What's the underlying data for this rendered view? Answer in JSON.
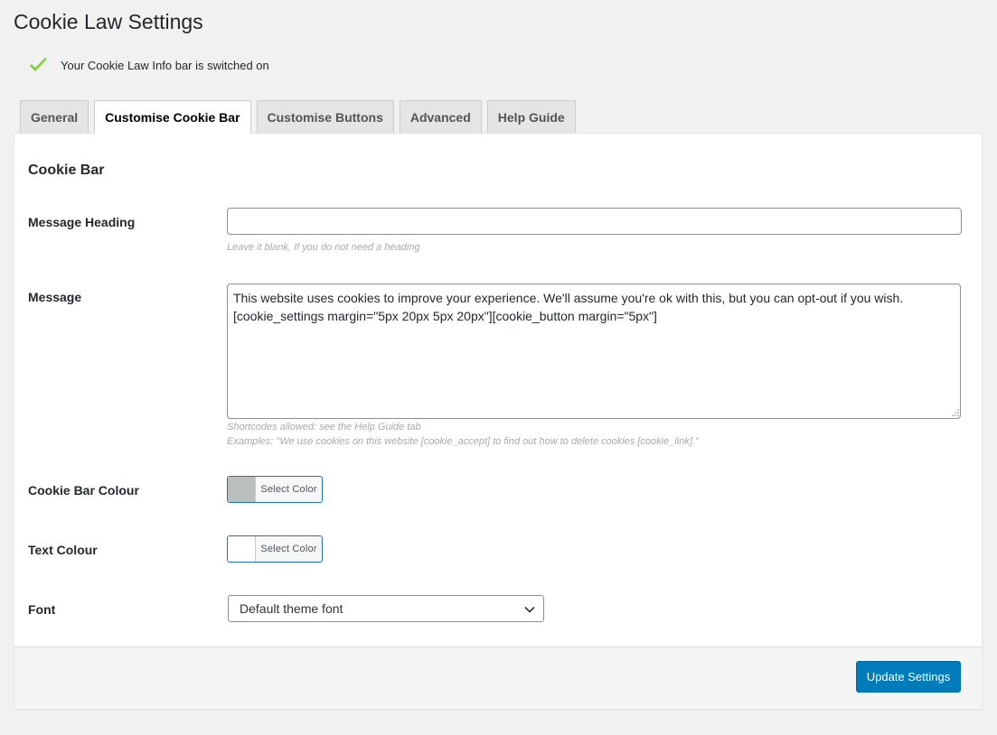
{
  "page": {
    "title": "Cookie Law Settings"
  },
  "notice": {
    "text": "Your Cookie Law Info bar is switched on",
    "icon": "checkmark-icon"
  },
  "tabs": [
    {
      "label": "General",
      "active": false
    },
    {
      "label": "Customise Cookie Bar",
      "active": true
    },
    {
      "label": "Customise Buttons",
      "active": false
    },
    {
      "label": "Advanced",
      "active": false
    },
    {
      "label": "Help Guide",
      "active": false
    }
  ],
  "section": {
    "title": "Cookie Bar"
  },
  "fields": {
    "message_heading": {
      "label": "Message Heading",
      "value": "",
      "hint": "Leave it blank, If you do not need a heading"
    },
    "message": {
      "label": "Message",
      "value": "This website uses cookies to improve your experience. We'll assume you're ok with this, but you can opt-out if you wish.\n[cookie_settings margin=\"5px 20px 5px 20px\"][cookie_button margin=\"5px\"]",
      "hint1": "Shortcodes allowed: see the Help Guide tab",
      "hint2": "Examples: \"We use cookies on this website [cookie_accept] to find out how to delete cookies [cookie_link].\""
    },
    "bar_colour": {
      "label": "Cookie Bar Colour",
      "button_label": "Select Color",
      "color": "#b9bfbd"
    },
    "text_colour": {
      "label": "Text Colour",
      "button_label": "Select Color",
      "color": "#ffffff"
    },
    "font": {
      "label": "Font",
      "selected": "Default theme font"
    }
  },
  "footer": {
    "update_label": "Update Settings"
  },
  "colors": {
    "accent": "#007cba",
    "check": "#7ad03a"
  }
}
